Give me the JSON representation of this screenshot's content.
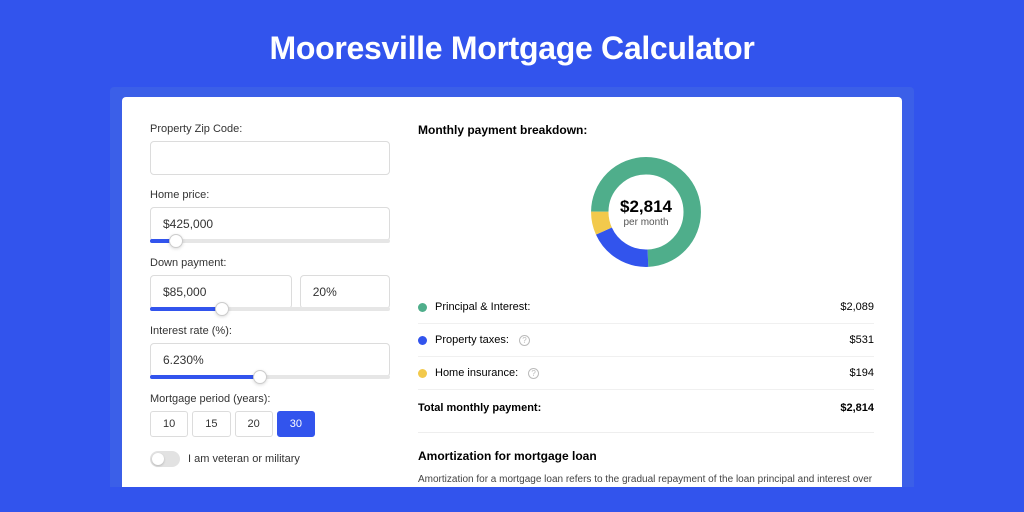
{
  "title": "Mooresville Mortgage Calculator",
  "colors": {
    "principal": "#4FAE8B",
    "taxes": "#3254ED",
    "insurance": "#F2C94C"
  },
  "form": {
    "zip_label": "Property Zip Code:",
    "zip_value": "",
    "home_price_label": "Home price:",
    "home_price_value": "$425,000",
    "home_price_slider_pct": 11,
    "down_label": "Down payment:",
    "down_value": "$85,000",
    "down_pct": "20%",
    "down_slider_pct": 30,
    "rate_label": "Interest rate (%):",
    "rate_value": "6.230%",
    "rate_slider_pct": 46,
    "period_label": "Mortgage period (years):",
    "period_options": [
      "10",
      "15",
      "20",
      "30"
    ],
    "period_selected": "30",
    "veteran_label": "I am veteran or military"
  },
  "breakdown": {
    "title": "Monthly payment breakdown:",
    "total_display": "$2,814",
    "per_month": "per month",
    "items": [
      {
        "key": "principal",
        "label": "Principal & Interest:",
        "amount": "$2,089",
        "value": 2089,
        "info": false
      },
      {
        "key": "taxes",
        "label": "Property taxes:",
        "amount": "$531",
        "value": 531,
        "info": true
      },
      {
        "key": "insurance",
        "label": "Home insurance:",
        "amount": "$194",
        "value": 194,
        "info": true
      }
    ],
    "total_label": "Total monthly payment:",
    "total_amount": "$2,814"
  },
  "amortization": {
    "title": "Amortization for mortgage loan",
    "text": "Amortization for a mortgage loan refers to the gradual repayment of the loan principal and interest over a specified"
  },
  "chart_data": {
    "type": "pie",
    "title": "Monthly payment breakdown",
    "series": [
      {
        "name": "Principal & Interest",
        "value": 2089
      },
      {
        "name": "Property taxes",
        "value": 531
      },
      {
        "name": "Home insurance",
        "value": 194
      }
    ],
    "total": 2814,
    "center_label": "$2,814 per month"
  }
}
